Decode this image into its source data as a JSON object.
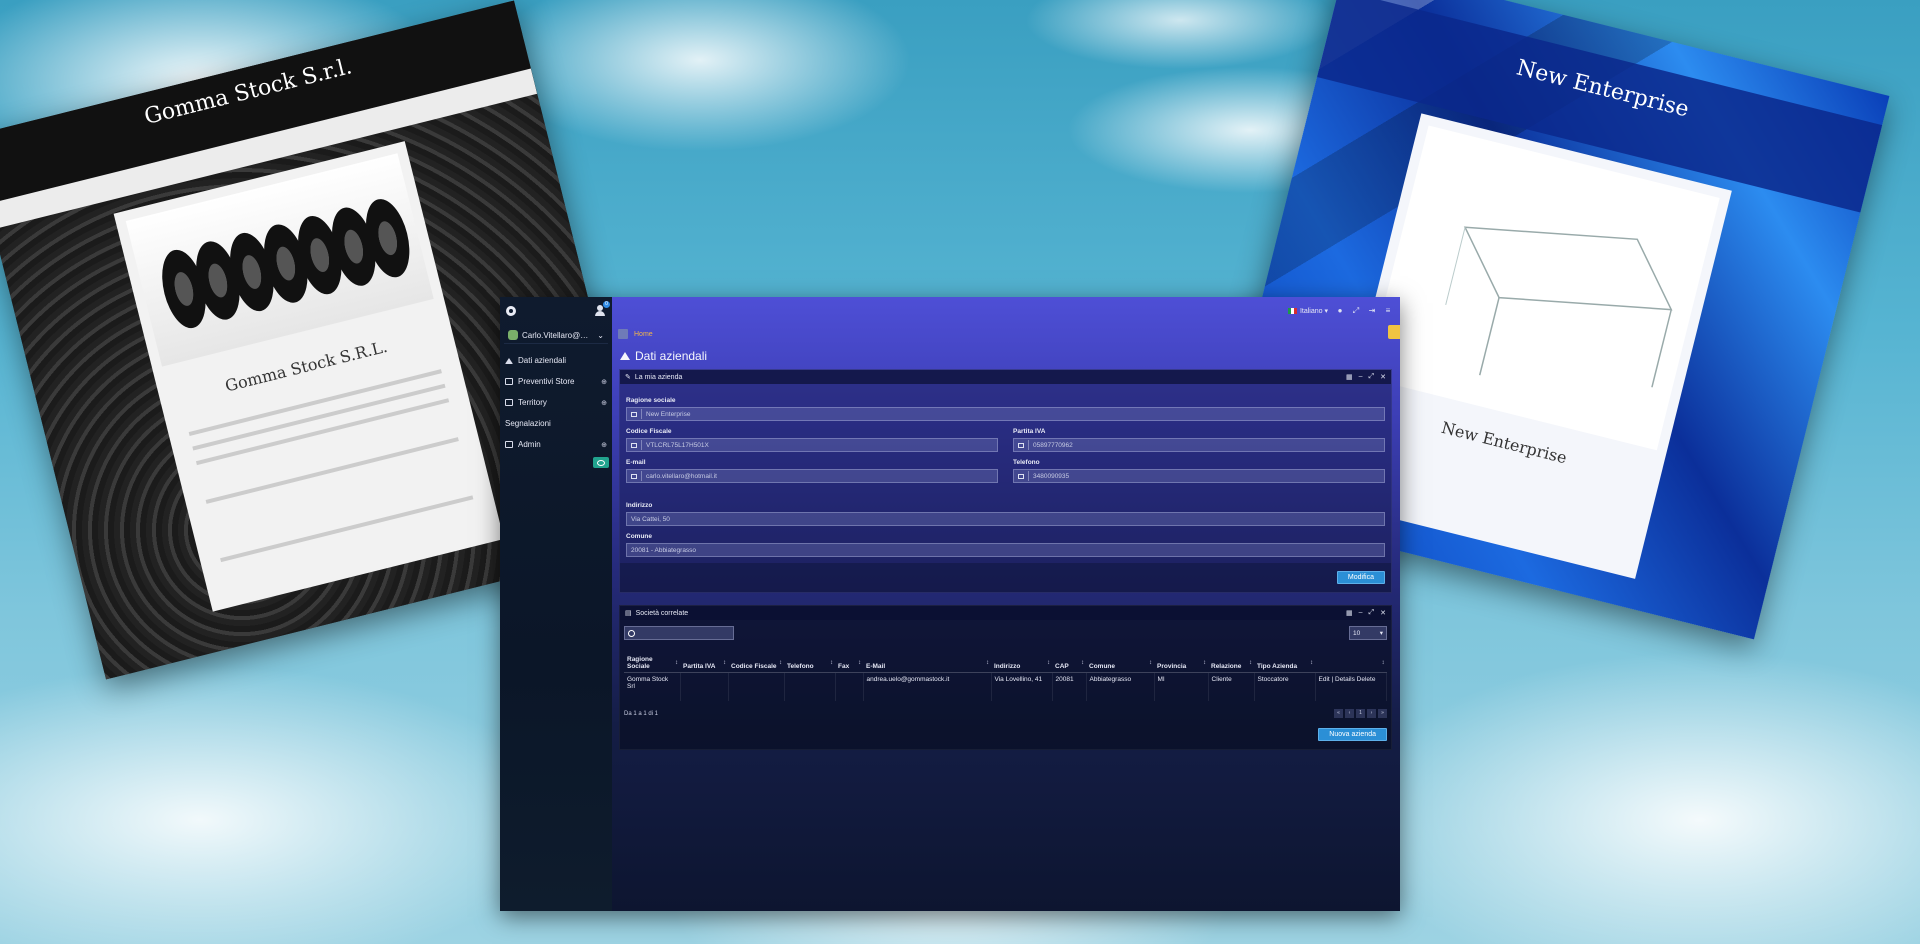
{
  "bg_left": {
    "title": "Gomma Stock S.r.l.",
    "card_title": "Gomma Stock S.R.L."
  },
  "bg_right": {
    "title": "New Enterprise",
    "card_title": "New Enterprise"
  },
  "sidebar": {
    "notification_count": "0",
    "account": "Carlo.Vitellaro@Hre...",
    "items": [
      {
        "label": "Dati aziendali",
        "icon": "home-icon"
      },
      {
        "label": "Preventivi Store",
        "icon": "store-icon",
        "expand": "⊕"
      },
      {
        "label": "Territory",
        "icon": "map-icon",
        "expand": "⊕"
      },
      {
        "label": "Segnalazioni",
        "icon": ""
      },
      {
        "label": "Admin",
        "icon": "admin-icon",
        "expand": "⊕"
      }
    ]
  },
  "topbar": {
    "language": "Italiano ▾"
  },
  "breadcrumb": {
    "home": "Home"
  },
  "page": {
    "title": "Dati aziendali"
  },
  "company_panel": {
    "title": "La mia azienda",
    "fields": {
      "ragione_sociale": {
        "label": "Ragione sociale",
        "value": "New Enterprise"
      },
      "codice_fiscale": {
        "label": "Codice Fiscale",
        "value": "VTLCRL75L17H501X"
      },
      "partita_iva": {
        "label": "Partita IVA",
        "value": "05897770962"
      },
      "email": {
        "label": "E-mail",
        "value": "carlo.vitellaro@hotmail.it"
      },
      "telefono": {
        "label": "Telefono",
        "value": "3480090935"
      },
      "indirizzo": {
        "label": "Indirizzo",
        "value": "Via Cattei, 50"
      },
      "comune": {
        "label": "Comune",
        "value": "20081 - Abbiategrasso"
      }
    },
    "edit_button": "Modifica"
  },
  "companies_panel": {
    "title": "Società correlate",
    "page_size": "10",
    "columns": [
      "Ragione Sociale",
      "Partita IVA",
      "Codice Fiscale",
      "Telefono",
      "Fax",
      "E-Mail",
      "Indirizzo",
      "CAP",
      "Comune",
      "Provincia",
      "Relazione",
      "Tipo Azienda",
      ""
    ],
    "rows": [
      [
        "Gomma Stock Srl",
        "",
        "",
        "",
        "",
        "andrea.uelo@gommastock.it",
        "Via Lovellino, 41",
        "20081",
        "Abbiategrasso",
        "MI",
        "Cliente",
        "Stoccatore",
        "Edit | Details Delete"
      ]
    ],
    "summary": "Da 1 a 1 di 1",
    "pager": [
      "«",
      "‹",
      "1",
      "›",
      "»"
    ],
    "new_button": "Nuova azienda"
  },
  "colors": {
    "accent": "#2b8fd6",
    "breadcrumb": "#f2b64a",
    "toggle": "#21a38e"
  }
}
